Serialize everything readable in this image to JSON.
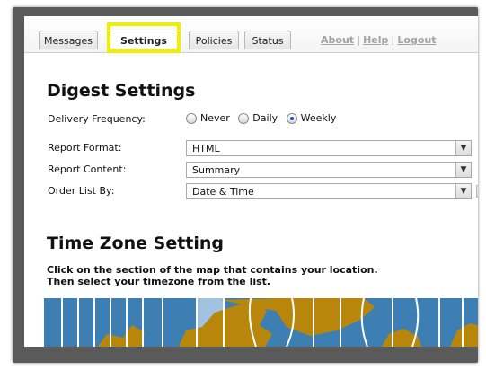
{
  "tabs": [
    {
      "label": "Messages",
      "active": false
    },
    {
      "label": "Settings",
      "active": true
    },
    {
      "label": "Policies",
      "active": false
    },
    {
      "label": "Status",
      "active": false
    }
  ],
  "top_links": {
    "about": "About",
    "help": "Help",
    "logout": "Logout",
    "separator": "|"
  },
  "digest": {
    "title": "Digest Settings",
    "frequency_label": "Delivery Frequency:",
    "frequency_options": [
      "Never",
      "Daily",
      "Weekly"
    ],
    "frequency_selected": "Weekly",
    "format_label": "Report Format:",
    "format_value": "HTML",
    "content_label": "Report Content:",
    "content_value": "Summary",
    "order_label": "Order List By:",
    "order_value": "Date & Time"
  },
  "timezone": {
    "title": "Time Zone Setting",
    "instruction_line1": "Click on the section of the map that contains your location.",
    "instruction_line2": "Then select your timezone from the list."
  },
  "colors": {
    "highlight": "#f2ee00",
    "map_ocean": "#3d7fb3",
    "map_land": "#b8860b",
    "map_selected_zone": "#9fc3e0"
  },
  "icons": {
    "dropdown": "chevron-down-icon"
  }
}
